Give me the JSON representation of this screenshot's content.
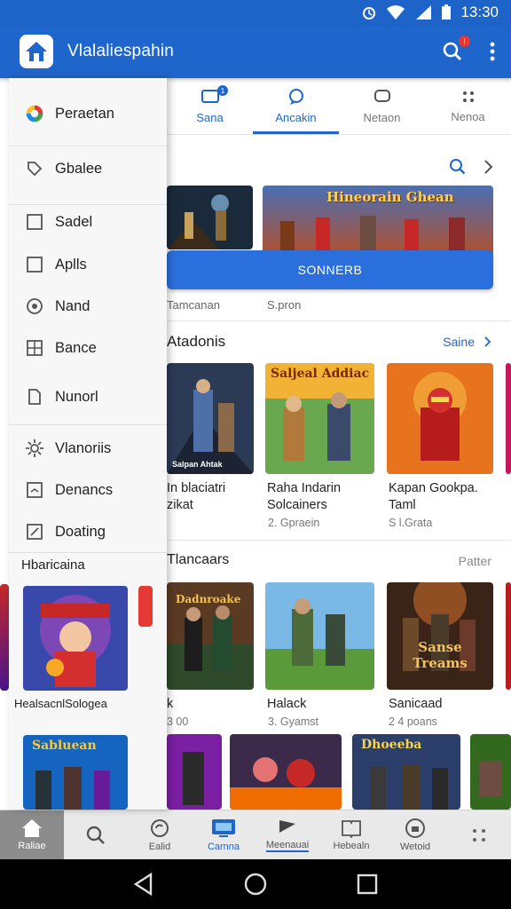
{
  "status": {
    "time": "13:30"
  },
  "app": {
    "title": "Vlalaliespahin"
  },
  "tabs": [
    {
      "label": "Sana"
    },
    {
      "label": "Ancakin"
    },
    {
      "label": "Netaon"
    },
    {
      "label": "Nenoa"
    }
  ],
  "featured": {
    "banner_title": "Hineorain Ghean",
    "button_label": "SONNERB",
    "captions": [
      "Tamcanan",
      "S.pron"
    ]
  },
  "section1": {
    "title": "Atadonis",
    "more": "Saine",
    "games": [
      {
        "art": "Salpan Ahtak",
        "title": "In blaciatri\nzikat",
        "sub": ""
      },
      {
        "art": "Saljeal Addiac",
        "title": "Raha Indarin\nSolcainers",
        "sub": "2. Gpraein"
      },
      {
        "art": "",
        "title": "Kapan Gookpa.\nTaml",
        "sub": "S l.Grata"
      }
    ]
  },
  "section2": {
    "title": "Tlancaars",
    "more": "Patter",
    "games": [
      {
        "art": "Dadnroake",
        "title": "k",
        "sub": "3 00"
      },
      {
        "art": "",
        "title": "Halack",
        "sub": "3. Gyamst"
      },
      {
        "art": "Sanse Treams",
        "title": "Sanicaad",
        "sub": "2 4 poans"
      }
    ]
  },
  "section3": {
    "arts": [
      "",
      "",
      "",
      "Dhoeeba",
      ""
    ]
  },
  "drawer": {
    "items": [
      {
        "label": "Peraetan",
        "icon": "brand-icon"
      },
      {
        "label": "Gbalee",
        "icon": "tag-icon"
      },
      {
        "label": "Sadel",
        "icon": "square-icon"
      },
      {
        "label": "Aplls",
        "icon": "square-icon"
      },
      {
        "label": "Nand",
        "icon": "circle-icon"
      },
      {
        "label": "Bance",
        "icon": "grid-icon"
      },
      {
        "label": "Nunorl",
        "icon": "document-icon"
      },
      {
        "label": "Vlanoriis",
        "icon": "gear-icon"
      },
      {
        "label": "Denancs",
        "icon": "image-icon"
      },
      {
        "label": "Doating",
        "icon": "edit-icon"
      }
    ],
    "subheader": "Hbaricaina",
    "card_caption": "HealsacnlSologea",
    "card_art": "Sabluean"
  },
  "bottom_nav": [
    {
      "label": "Raliae",
      "icon": "home-icon"
    },
    {
      "label": "",
      "icon": "search-icon"
    },
    {
      "label": "Ealid",
      "icon": "refresh-icon"
    },
    {
      "label": "Carnna",
      "icon": "tv-icon"
    },
    {
      "label": "Meenauai",
      "icon": "flag-icon"
    },
    {
      "label": "Hebealn",
      "icon": "book-icon"
    },
    {
      "label": "Wetoid",
      "icon": "shield-icon"
    },
    {
      "label": "",
      "icon": "dots-icon"
    }
  ],
  "colors": {
    "primary": "#1f66cc",
    "accent_red": "#e53935"
  }
}
